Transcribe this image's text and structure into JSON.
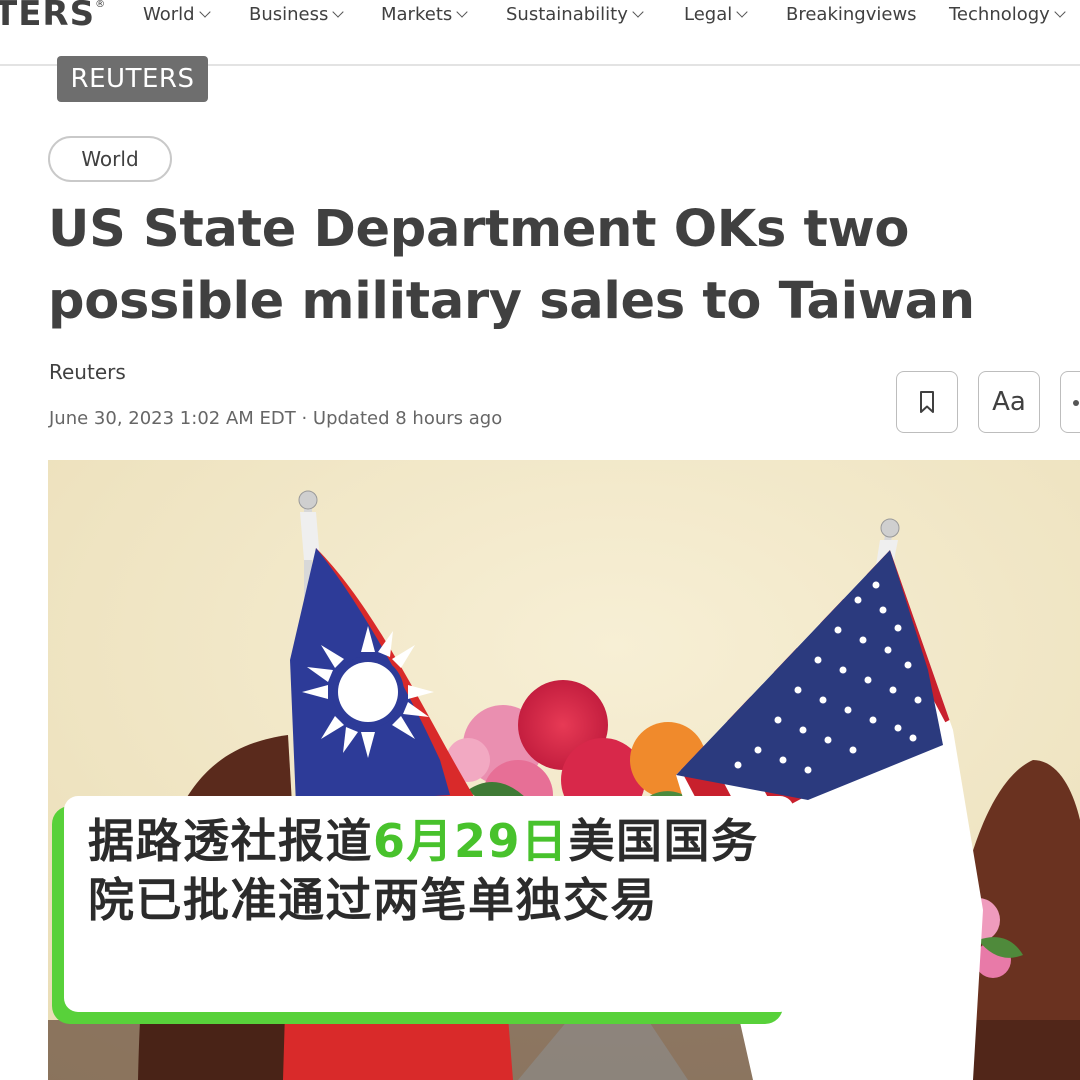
{
  "nav": {
    "logo": "TERS",
    "logo_mark": "®",
    "items": [
      {
        "label": "World",
        "has_menu": true
      },
      {
        "label": "Business",
        "has_menu": true
      },
      {
        "label": "Markets",
        "has_menu": true
      },
      {
        "label": "Sustainability",
        "has_menu": true
      },
      {
        "label": "Legal",
        "has_menu": true
      },
      {
        "label": "Breakingviews",
        "has_menu": false
      },
      {
        "label": "Technology",
        "has_menu": true
      }
    ]
  },
  "watermark": "REUTERS",
  "article": {
    "section": "World",
    "headline": "US State Department OKs two possible military sales to Taiwan",
    "author": "Reuters",
    "date": "June 30, 2023 1:02 AM EDT · Updated 8 hours ago",
    "tools": {
      "bookmark_icon": "bookmark-icon",
      "font_size_label": "Aa",
      "share_icon": "more-icon"
    }
  },
  "caption": {
    "before": "据路透社报道",
    "highlight": "6月29日",
    "after": "美国国务院已批准通过两笔单独交易",
    "highlight_color": "#48c22c",
    "accent_color": "#58d13a"
  },
  "photo": {
    "subject": "taiwan-and-us-flags-with-flowers"
  }
}
